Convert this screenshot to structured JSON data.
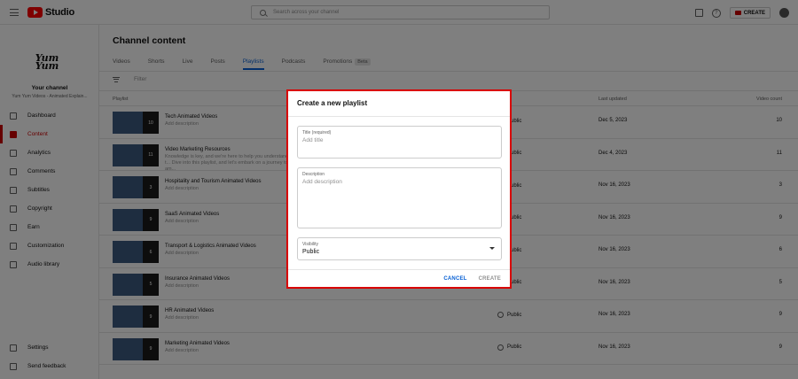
{
  "topbar": {
    "logo_text": "Studio",
    "search_placeholder": "Search across your channel",
    "create_label": "CREATE"
  },
  "sidebar": {
    "avatar_text": "Yum Yum",
    "your_channel": "Your channel",
    "channel_name": "Yum Yum Videos - Animated Explain...",
    "items": [
      {
        "label": "Dashboard",
        "icon": "dashboard-icon"
      },
      {
        "label": "Content",
        "icon": "content-icon",
        "active": true
      },
      {
        "label": "Analytics",
        "icon": "analytics-icon"
      },
      {
        "label": "Comments",
        "icon": "comments-icon"
      },
      {
        "label": "Subtitles",
        "icon": "subtitles-icon"
      },
      {
        "label": "Copyright",
        "icon": "copyright-icon"
      },
      {
        "label": "Earn",
        "icon": "earn-icon"
      },
      {
        "label": "Customization",
        "icon": "customization-icon"
      },
      {
        "label": "Audio library",
        "icon": "audio-library-icon"
      }
    ],
    "bottom_items": [
      {
        "label": "Settings",
        "icon": "gear-icon"
      },
      {
        "label": "Send feedback",
        "icon": "feedback-icon"
      }
    ]
  },
  "main": {
    "title": "Channel content",
    "tabs": [
      "Videos",
      "Shorts",
      "Live",
      "Posts",
      "Playlists",
      "Podcasts",
      "Promotions"
    ],
    "active_tab": "Playlists",
    "beta_label": "Beta",
    "filter_placeholder": "Filter",
    "columns": {
      "playlist": "Playlist",
      "last_updated": "Last updated",
      "video_count": "Video count"
    },
    "rows": [
      {
        "title": "Tech Animated Videos",
        "desc": "Add description",
        "visibility": "Public",
        "updated": "Dec 5, 2023",
        "count": "10",
        "thumb_count": "10"
      },
      {
        "title": "Video Marketing Resources",
        "desc": "Knowledge is key, and we're here to help you understand t... Dive into this playlist, and let's embark on a journey to am...",
        "visibility": "Public",
        "updated": "Dec 4, 2023",
        "count": "11",
        "thumb_count": "11"
      },
      {
        "title": "Hospitality and Tourism Animated Videos",
        "desc": "Add description",
        "visibility": "Public",
        "updated": "Nov 16, 2023",
        "count": "3",
        "thumb_count": "3"
      },
      {
        "title": "SaaS Animated Videos",
        "desc": "Add description",
        "visibility": "Public",
        "updated": "Nov 16, 2023",
        "count": "9",
        "thumb_count": "9"
      },
      {
        "title": "Transport & Logistics Animated Videos",
        "desc": "Add description",
        "visibility": "Public",
        "updated": "Nov 16, 2023",
        "count": "6",
        "thumb_count": "6"
      },
      {
        "title": "Insurance Animated Videos",
        "desc": "Add description",
        "visibility": "Public",
        "updated": "Nov 16, 2023",
        "count": "5",
        "thumb_count": "5"
      },
      {
        "title": "HR Animated Videos",
        "desc": "Add description",
        "visibility": "Public",
        "updated": "Nov 16, 2023",
        "count": "9",
        "thumb_count": "9"
      },
      {
        "title": "Marketing Animated Videos",
        "desc": "Add description",
        "visibility": "Public",
        "updated": "Nov 16, 2023",
        "count": "9",
        "thumb_count": "9"
      }
    ]
  },
  "dialog": {
    "title": "Create a new playlist",
    "title_label": "Title (required)",
    "title_placeholder": "Add title",
    "description_label": "Description",
    "description_placeholder": "Add description",
    "visibility_label": "Visibility",
    "visibility_value": "Public",
    "cancel_label": "CANCEL",
    "create_label": "CREATE"
  },
  "colors": {
    "accent": "#065fd4",
    "brand": "#ff0000",
    "highlight_border": "#d90000"
  }
}
